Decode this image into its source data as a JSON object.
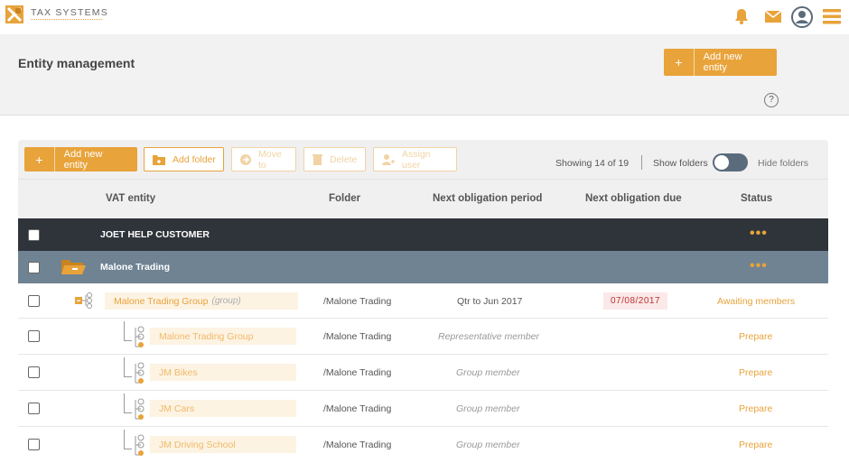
{
  "brand": {
    "name": "TAX SYSTEMS",
    "accent": "#e8a33a"
  },
  "top_icons": [
    "bell-icon",
    "mail-icon",
    "user-icon",
    "menu-icon"
  ],
  "header": {
    "title": "Entity management",
    "add_label": "Add new entity",
    "help": "?"
  },
  "toolbar": {
    "add_entity": "Add new entity",
    "add_folder": "Add folder",
    "move_to": "Move to",
    "delete": "Delete",
    "assign_user": "Assign user",
    "showing": "Showing 14 of 19",
    "show_folders": "Show folders",
    "hide_folders": "Hide folders"
  },
  "columns": {
    "entity": "VAT entity",
    "folder": "Folder",
    "period": "Next obligation period",
    "due": "Next obligation due",
    "status": "Status"
  },
  "rows": {
    "customer": {
      "name": "JOET HELP CUSTOMER",
      "more": "•••"
    },
    "folder": {
      "name": "Malone Trading",
      "more": "•••"
    },
    "group": {
      "name": "Malone Trading Group",
      "tag": "(group)",
      "folder": "/Malone Trading",
      "period": "Qtr to Jun 2017",
      "due": "07/08/2017",
      "status": "Awaiting members"
    },
    "members": [
      {
        "name": "Malone Trading Group",
        "folder": "/Malone Trading",
        "period": "Representative member",
        "status": "Prepare"
      },
      {
        "name": "JM Bikes",
        "folder": "/Malone Trading",
        "period": "Group member",
        "status": "Prepare"
      },
      {
        "name": "JM Cars",
        "folder": "/Malone Trading",
        "period": "Group member",
        "status": "Prepare"
      },
      {
        "name": "JM Driving School",
        "folder": "/Malone Trading",
        "period": "Group member",
        "status": "Prepare"
      }
    ]
  }
}
